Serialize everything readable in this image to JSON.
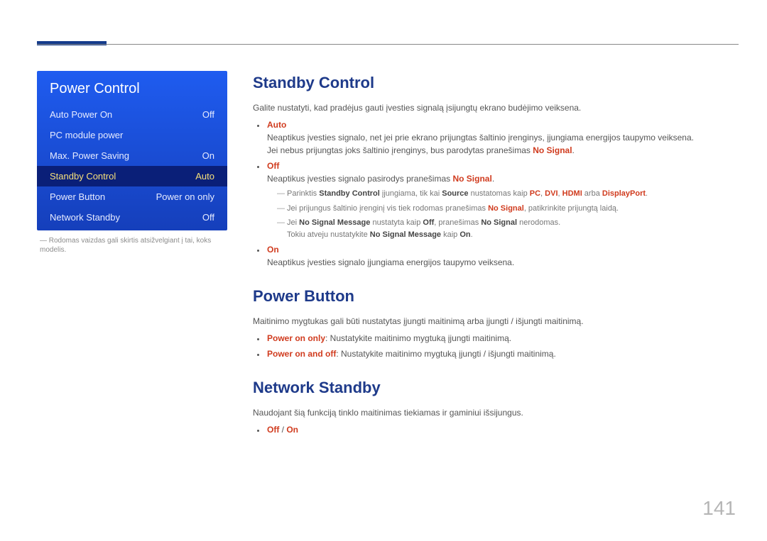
{
  "menu": {
    "title": "Power Control",
    "items": [
      {
        "label": "Auto Power On",
        "value": "Off"
      },
      {
        "label": "PC module power",
        "value": ""
      },
      {
        "label": "Max. Power Saving",
        "value": "On"
      },
      {
        "label": "Standby Control",
        "value": "Auto"
      },
      {
        "label": "Power Button",
        "value": "Power on only"
      },
      {
        "label": "Network Standby",
        "value": "Off"
      }
    ],
    "note": "― Rodomas vaizdas gali skirtis atsižvelgiant į tai, koks modelis."
  },
  "standby": {
    "heading": "Standby Control",
    "intro": "Galite nustatyti, kad pradėjus gauti įvesties signalą įsijungtų ekrano budėjimo veiksena.",
    "auto_label": "Auto",
    "auto_line1": "Neaptikus įvesties signalo, net jei prie ekrano prijungtas šaltinio įrenginys, įjungiama energijos taupymo veiksena.",
    "auto_line2_a": "Jei nebus prijungtas joks šaltinio įrenginys, bus parodytas pranešimas ",
    "auto_line2_b": "No Signal",
    "auto_line2_c": ".",
    "off_label": "Off",
    "off_line1_a": "Neaptikus įvesties signalo pasirodys pranešimas ",
    "off_line1_b": "No Signal",
    "off_line1_c": ".",
    "off_sub1_a": "Parinktis ",
    "off_sub1_b": "Standby Control",
    "off_sub1_c": " įjungiama, tik kai ",
    "off_sub1_d": "Source",
    "off_sub1_e": " nustatomas kaip ",
    "off_sub1_f": "PC",
    "off_sub1_g": ", ",
    "off_sub1_h": "DVI",
    "off_sub1_i": ", ",
    "off_sub1_j": "HDMI",
    "off_sub1_k": " arba ",
    "off_sub1_l": "DisplayPort",
    "off_sub1_m": ".",
    "off_sub2_a": "Jei prijungus šaltinio įrenginį vis tiek rodomas pranešimas ",
    "off_sub2_b": "No Signal",
    "off_sub2_c": ", patikrinkite prijungtą laidą.",
    "off_sub3_a": "Jei ",
    "off_sub3_b": "No Signal Message",
    "off_sub3_c": " nustatyta kaip ",
    "off_sub3_d": "Off",
    "off_sub3_e": ", pranešimas ",
    "off_sub3_f": "No Signal",
    "off_sub3_g": " nerodomas.",
    "off_sub3_line2_a": "Tokiu atveju nustatykite ",
    "off_sub3_line2_b": "No Signal Message",
    "off_sub3_line2_c": " kaip ",
    "off_sub3_line2_d": "On",
    "off_sub3_line2_e": ".",
    "on_label": "On",
    "on_line1": "Neaptikus įvesties signalo įjungiama energijos taupymo veiksena."
  },
  "powerbutton": {
    "heading": "Power Button",
    "intro": "Maitinimo mygtukas gali būti nustatytas įjungti maitinimą arba įjungti / išjungti maitinimą.",
    "b1_a": "Power on only",
    "b1_b": ": Nustatykite maitinimo mygtuką įjungti maitinimą.",
    "b2_a": "Power on and off",
    "b2_b": ": Nustatykite maitinimo mygtuką įjungti / išjungti maitinimą."
  },
  "network": {
    "heading": "Network Standby",
    "intro": "Naudojant šią funkciją tinklo maitinimas tiekiamas ir gaminiui išsijungus.",
    "opt_off": "Off",
    "opt_sep": " / ",
    "opt_on": "On"
  },
  "page": "141"
}
